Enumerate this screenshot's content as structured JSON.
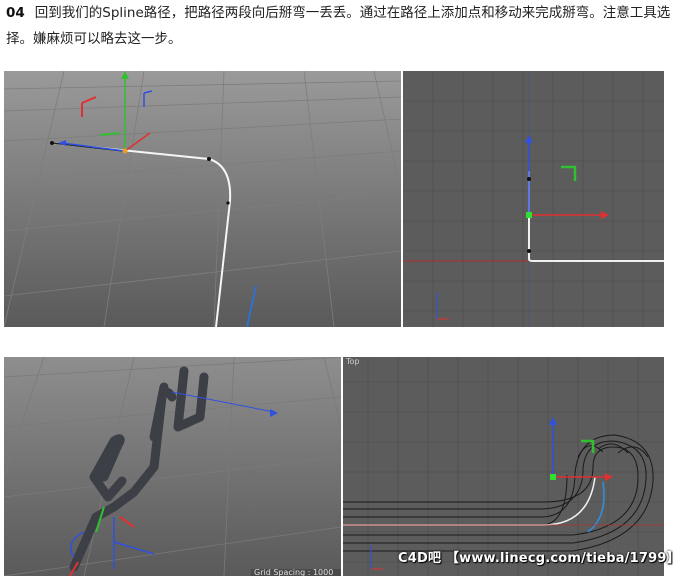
{
  "step": {
    "number": "04",
    "text": "回到我们的Spline路径，把路径两段向后掰弯一丢丢。通过在路径上添加点和移动来完成掰弯。注意工具选择。嫌麻烦可以略去这一步。"
  },
  "viewports": {
    "top_right_label": "Top",
    "grid_spacing": "Grid Spacing : 1000 cm"
  },
  "watermark": "C4D吧 【www.linecg.com/tieba/1799】",
  "colors": {
    "viewport_bg": "#6b6b6b",
    "axis_x": "#e03030",
    "axis_y": "#30c030",
    "axis_z": "#3050e0"
  }
}
